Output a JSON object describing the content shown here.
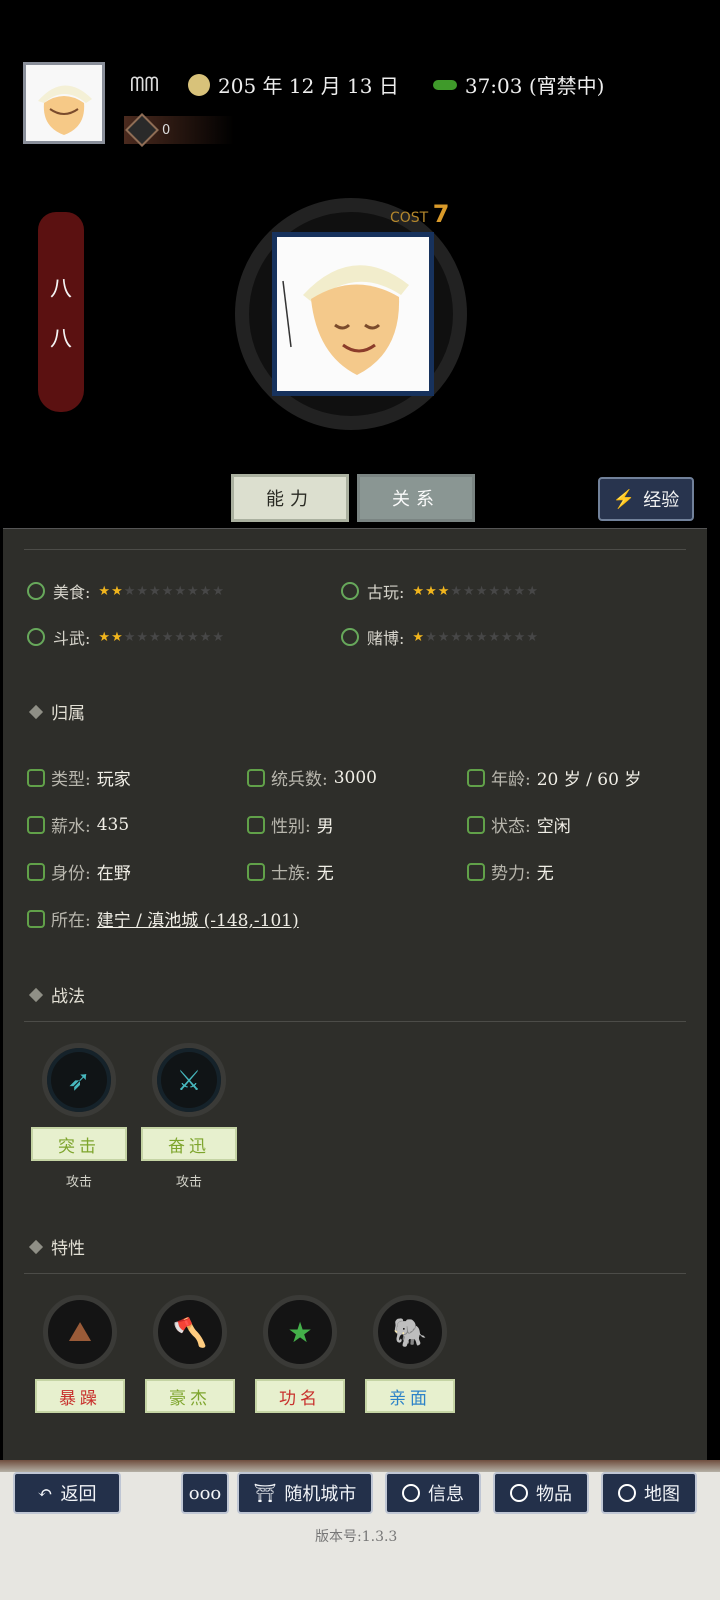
{
  "header": {
    "name": "ᗰᗰ",
    "date": "205 年 12 月 13 日",
    "time": "37:03 (宵禁中)",
    "coin_count": "0"
  },
  "character": {
    "banner_text": [
      "八",
      "八"
    ],
    "cost_label": "COST",
    "cost_value": "7"
  },
  "tabs": {
    "ability": "能力",
    "relation": "关系",
    "experience": "经验"
  },
  "skills": [
    {
      "label": "美食:",
      "rating": 2,
      "max": 10
    },
    {
      "label": "古玩:",
      "rating": 3,
      "max": 10
    },
    {
      "label": "斗武:",
      "rating": 2,
      "max": 10
    },
    {
      "label": "赌博:",
      "rating": 1,
      "max": 10
    }
  ],
  "affiliation": {
    "title": "归属",
    "type_label": "类型:",
    "type_value": "玩家",
    "troops_label": "统兵数:",
    "troops_value": "3000",
    "age_label": "年龄:",
    "age_value": "20 岁 / 60 岁",
    "salary_label": "薪水:",
    "salary_value": "435",
    "gender_label": "性别:",
    "gender_value": "男",
    "status_label": "状态:",
    "status_value": "空闲",
    "identity_label": "身份:",
    "identity_value": "在野",
    "clan_label": "士族:",
    "clan_value": "无",
    "force_label": "势力:",
    "force_value": "无",
    "location_label": "所在:",
    "location_value": "建宁 / 滇池城 (-148,-101)"
  },
  "tactics": {
    "title": "战法",
    "items": [
      {
        "name": "突击",
        "type": "攻击"
      },
      {
        "name": "奋迅",
        "type": "攻击"
      }
    ]
  },
  "traits": {
    "title": "特性",
    "items": [
      {
        "name": "暴躁",
        "color": "#c8302c"
      },
      {
        "name": "豪杰",
        "color": "#7ea52d"
      },
      {
        "name": "功名",
        "color": "#c8302c"
      },
      {
        "name": "亲面",
        "color": "#2c82c8"
      }
    ]
  },
  "footer": {
    "back": "返回",
    "more": "ooo",
    "random_city": "随机城市",
    "info": "信息",
    "items": "物品",
    "map": "地图",
    "version": "版本号:1.3.3"
  }
}
